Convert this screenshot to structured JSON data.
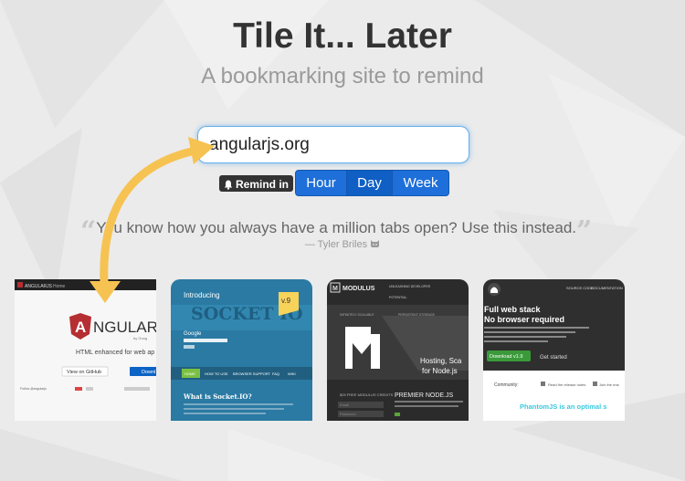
{
  "header": {
    "title": "Tile It... Later",
    "subtitle": "A bookmarking site to remind"
  },
  "url_input": {
    "value": "angularjs.org"
  },
  "remind": {
    "label": "Remind in",
    "options": [
      "Hour",
      "Day",
      "Week"
    ],
    "selected": "Day"
  },
  "testimonial": {
    "quote": "You know how you always have a million tabs open? Use this instead.",
    "author": "— Tyler Briles"
  },
  "tiles": [
    {
      "site": "angular",
      "header_text": "ANGULARJS",
      "nav_text": "Home",
      "logo_text": "NGULARJS",
      "byline": "by Goog",
      "tagline": "HTML enhanced for web ap",
      "btn1": "View on GitHub",
      "btn2": "Downl",
      "footer": "Follow @angularjs"
    },
    {
      "site": "socketio",
      "intro": "Introducing",
      "logo": "SOCKET IO",
      "version": "v.9",
      "google_text": "Google",
      "nav": [
        "HOME",
        "HOW TO USE",
        "BROWSER SUPPORT",
        "FAQ",
        "WIKI"
      ],
      "heading": "What is Socket.IO?"
    },
    {
      "site": "modulus",
      "brand": "MODULUS",
      "nav1": "UNLEASHING DEVELOPER",
      "nav2": "POTENTIAL",
      "feat1": "INFINITELY SCALABLE",
      "feat2": "PERSISTENT STORAGE",
      "hosting1": "Hosting, Sca",
      "hosting2": "for Node.js",
      "credits": "$25 FREE MODULUS CREDITS",
      "premier": "PREMIER NODE.JS",
      "field1": "Email",
      "field2": "Password"
    },
    {
      "site": "phantomjs",
      "nav1": "SOURCE CODE",
      "nav2": "DOCUMENTATION",
      "headline1": "Full web stack",
      "headline2": "No browser required",
      "download": "Download v1.9",
      "started": "Get started",
      "community": "Community:",
      "release": "Read the release notes",
      "join": "Join the mai",
      "tagline": "PhantomJS is an optimal s"
    }
  ],
  "colors": {
    "primary": "#1e6fd9",
    "arrow": "#f6c352",
    "phantom_accent": "#3ac8df"
  }
}
